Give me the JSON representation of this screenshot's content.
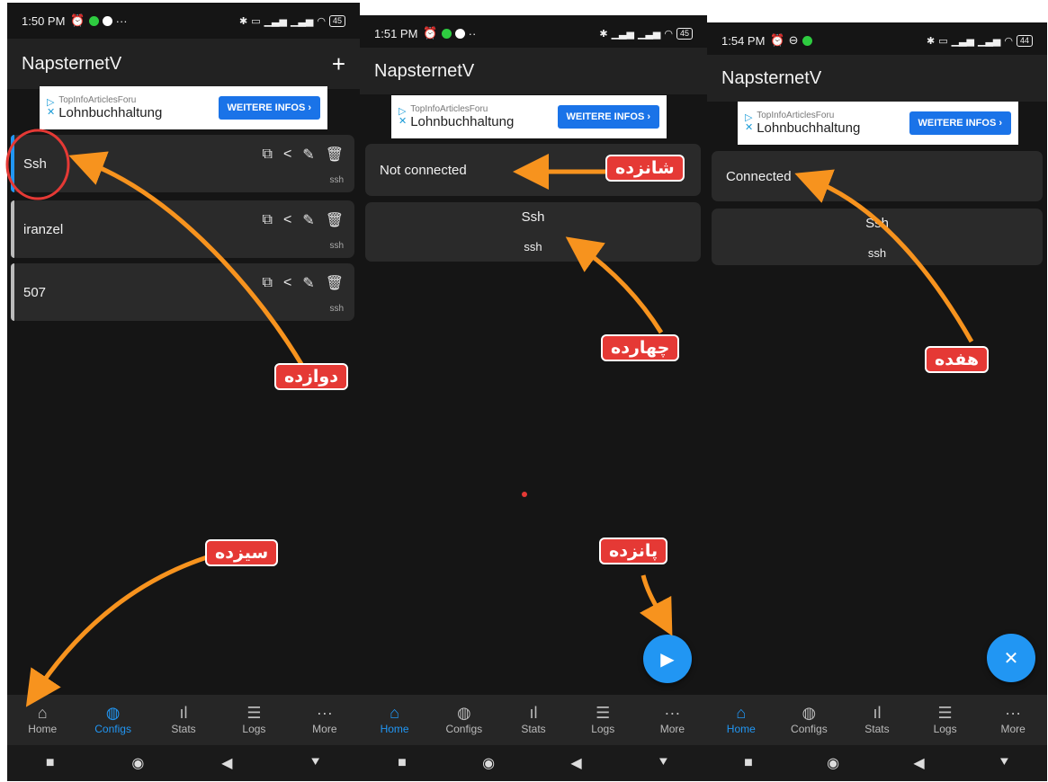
{
  "colors": {
    "accent": "#2196f3",
    "arrow": "#f7931e",
    "tag_bg": "#e53935",
    "circle": "#e53935"
  },
  "screen1": {
    "status": {
      "time": "1:50 PM",
      "battery": "45"
    },
    "app_title": "NapsternetV",
    "ad": {
      "source": "TopInfoArticlesForu",
      "title": "Lohnbuchhaltung",
      "button": "WEITERE INFOS ›"
    },
    "configs": [
      {
        "name": "Ssh",
        "type": "ssh",
        "active": true
      },
      {
        "name": "iranzel",
        "type": "ssh",
        "active": false
      },
      {
        "name": "507",
        "type": "ssh",
        "active": false
      }
    ],
    "nav": [
      {
        "label": "Home",
        "icon": "home-icon"
      },
      {
        "label": "Configs",
        "icon": "globe-icon",
        "active": true
      },
      {
        "label": "Stats",
        "icon": "bar-chart-icon"
      },
      {
        "label": "Logs",
        "icon": "list-icon"
      },
      {
        "label": "More",
        "icon": "more-icon"
      }
    ],
    "annotations": {
      "tag_a": "دوازده",
      "tag_b": "سیزده"
    }
  },
  "screen2": {
    "status": {
      "time": "1:51 PM",
      "battery": "45"
    },
    "app_title": "NapsternetV",
    "ad": {
      "source": "TopInfoArticlesForu",
      "title": "Lohnbuchhaltung",
      "button": "WEITERE INFOS ›"
    },
    "connection_status": "Not connected",
    "server": {
      "name": "Ssh",
      "type": "ssh"
    },
    "fab_icon": "play-icon",
    "nav": [
      {
        "label": "Home",
        "icon": "home-icon",
        "active": true
      },
      {
        "label": "Configs",
        "icon": "globe-icon"
      },
      {
        "label": "Stats",
        "icon": "bar-chart-icon"
      },
      {
        "label": "Logs",
        "icon": "list-icon"
      },
      {
        "label": "More",
        "icon": "more-icon"
      }
    ],
    "annotations": {
      "tag_a": "شانزده",
      "tag_b": "چهارده",
      "tag_c": "پانزده"
    }
  },
  "screen3": {
    "status": {
      "time": "1:54 PM",
      "battery": "44"
    },
    "app_title": "NapsternetV",
    "ad": {
      "source": "TopInfoArticlesForu",
      "title": "Lohnbuchhaltung",
      "button": "WEITERE INFOS ›"
    },
    "connection_status": "Connected",
    "server": {
      "name": "Ssh",
      "type": "ssh"
    },
    "fab_icon": "close-icon",
    "nav": [
      {
        "label": "Home",
        "icon": "home-icon",
        "active": true
      },
      {
        "label": "Configs",
        "icon": "globe-icon"
      },
      {
        "label": "Stats",
        "icon": "bar-chart-icon"
      },
      {
        "label": "Logs",
        "icon": "list-icon"
      },
      {
        "label": "More",
        "icon": "more-icon"
      }
    ],
    "annotations": {
      "tag_a": "هفده"
    }
  }
}
